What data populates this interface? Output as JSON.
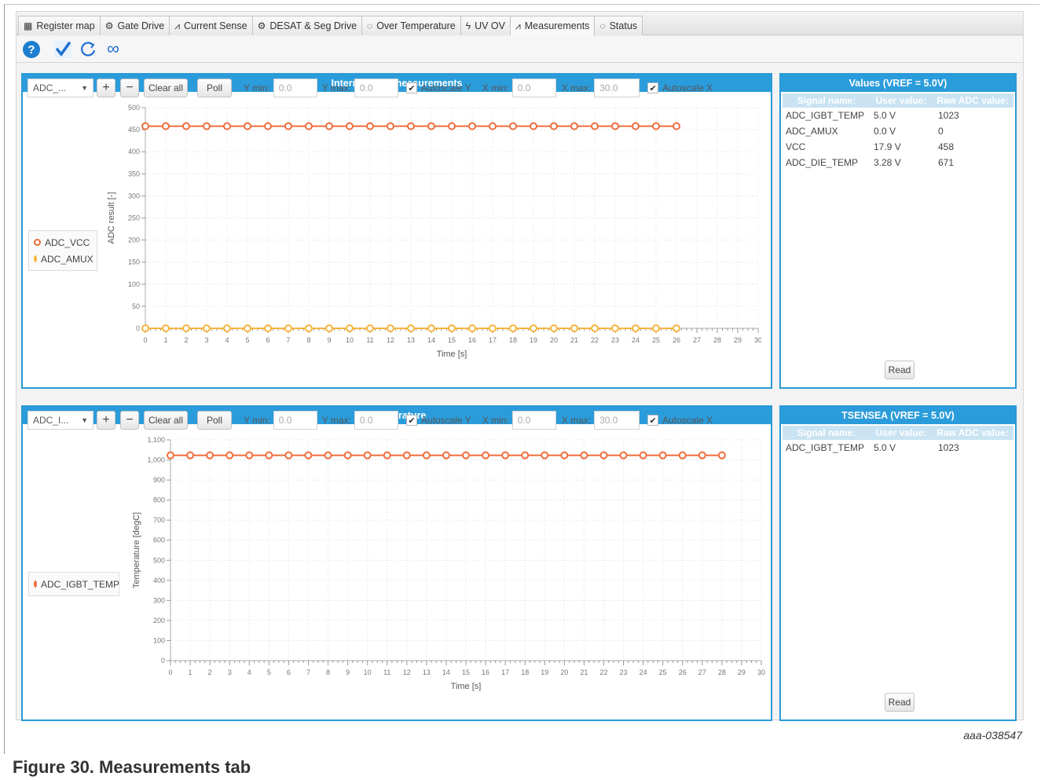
{
  "tabs": [
    {
      "label": "Register map",
      "icon": "grid-icon"
    },
    {
      "label": "Gate Drive",
      "icon": "gear-icon"
    },
    {
      "label": "Current Sense",
      "icon": "chart-icon"
    },
    {
      "label": "DESAT & Seg Drive",
      "icon": "gear-icon"
    },
    {
      "label": "Over Temperature",
      "icon": "shield-check-icon"
    },
    {
      "label": "UV OV",
      "icon": "lightning-icon"
    },
    {
      "label": "Measurements",
      "icon": "chart-icon"
    },
    {
      "label": "Status",
      "icon": "shield-check-icon"
    }
  ],
  "active_tab": "Measurements",
  "toolbar": {
    "help": "?",
    "check": "✔",
    "refresh": "⟳",
    "loop": "∞"
  },
  "adc_panel": {
    "title": "Internal ADC measurements",
    "dropdown": "ADC_...",
    "plus": "+",
    "minus": "−",
    "clear_all": "Clear all",
    "poll": "Poll",
    "ymin_label": "Y min:",
    "ymin_value": "0.0",
    "ymax_label": "Y max:",
    "ymax_value": "0.0",
    "autoscale_y": "Autoscale Y",
    "xmin_label": "X min:",
    "xmin_value": "0.0",
    "xmax_label": "X max:",
    "xmax_value": "30.0",
    "autoscale_x": "Autoscale X",
    "legend": [
      "ADC_VCC",
      "ADC_AMUX"
    ]
  },
  "temp_panel": {
    "title": "Temperature",
    "dropdown": "ADC_I...",
    "plus": "+",
    "minus": "−",
    "clear_all": "Clear all",
    "poll": "Poll",
    "ymin_label": "Y min:",
    "ymin_value": "0.0",
    "ymax_label": "Y max:",
    "ymax_value": "0.0",
    "autoscale_y": "Autoscale Y",
    "xmin_label": "X min:",
    "xmin_value": "0.0",
    "xmax_label": "X max:",
    "xmax_value": "30.0",
    "autoscale_x": "Autoscale X",
    "legend": [
      "ADC_IGBT_TEMP"
    ]
  },
  "values_panel": {
    "title": "Values (VREF = 5.0V)",
    "headers": [
      "Signal name:",
      "User value:",
      "Raw ADC value:"
    ],
    "rows": [
      [
        "ADC_IGBT_TEMP",
        "5.0 V",
        "1023"
      ],
      [
        "ADC_AMUX",
        "0.0 V",
        "0"
      ],
      [
        "VCC",
        "17.9 V",
        "458"
      ],
      [
        "ADC_DIE_TEMP",
        "3.28 V",
        "671"
      ]
    ],
    "read": "Read"
  },
  "tsense_panel": {
    "title": "TSENSEA (VREF = 5.0V)",
    "headers": [
      "Signal name:",
      "User value:",
      "Raw ADC value:"
    ],
    "rows": [
      [
        "ADC_IGBT_TEMP",
        "5.0 V",
        "1023"
      ]
    ],
    "read": "Read"
  },
  "chart_data": [
    {
      "type": "line",
      "title": "Internal ADC measurements",
      "xlabel": "Time [s]",
      "ylabel": "ADC result [-]",
      "xlim": [
        0,
        30
      ],
      "ylim": [
        0,
        500
      ],
      "xticks": [
        0,
        1,
        2,
        3,
        4,
        5,
        6,
        7,
        8,
        9,
        10,
        11,
        12,
        13,
        14,
        15,
        16,
        17,
        18,
        19,
        20,
        21,
        22,
        23,
        24,
        25,
        26,
        27,
        28,
        29,
        30
      ],
      "yticks": [
        0,
        50,
        100,
        150,
        200,
        250,
        300,
        350,
        400,
        450,
        500
      ],
      "grid": true,
      "legend_position": "left",
      "series": [
        {
          "name": "ADC_VCC",
          "color": "#ef6c3c",
          "x": [
            0,
            1,
            2,
            3,
            4,
            5,
            6,
            7,
            8,
            9,
            10,
            11,
            12,
            13,
            14,
            15,
            16,
            17,
            18,
            19,
            20,
            21,
            22,
            23,
            24,
            25,
            26
          ],
          "y": [
            458,
            458,
            458,
            458,
            458,
            458,
            458,
            458,
            458,
            458,
            458,
            458,
            458,
            458,
            458,
            458,
            458,
            458,
            458,
            458,
            458,
            458,
            458,
            458,
            458,
            458,
            458
          ]
        },
        {
          "name": "ADC_AMUX",
          "color": "#f4b43c",
          "x": [
            0,
            1,
            2,
            3,
            4,
            5,
            6,
            7,
            8,
            9,
            10,
            11,
            12,
            13,
            14,
            15,
            16,
            17,
            18,
            19,
            20,
            21,
            22,
            23,
            24,
            25,
            26
          ],
          "y": [
            0,
            0,
            0,
            0,
            0,
            0,
            0,
            0,
            0,
            0,
            0,
            0,
            0,
            0,
            0,
            0,
            0,
            0,
            0,
            0,
            0,
            0,
            0,
            0,
            0,
            0,
            0
          ]
        }
      ]
    },
    {
      "type": "line",
      "title": "Temperature",
      "xlabel": "Time [s]",
      "ylabel": "Temperature [degC]",
      "xlim": [
        0,
        30
      ],
      "ylim": [
        0,
        1100
      ],
      "xticks": [
        0,
        1,
        2,
        3,
        4,
        5,
        6,
        7,
        8,
        9,
        10,
        11,
        12,
        13,
        14,
        15,
        16,
        17,
        18,
        19,
        20,
        21,
        22,
        23,
        24,
        25,
        26,
        27,
        28,
        29,
        30
      ],
      "yticks": [
        0,
        100,
        200,
        300,
        400,
        500,
        600,
        700,
        800,
        900,
        1000,
        1100
      ],
      "ytick_labels": [
        "0",
        "100",
        "200",
        "300",
        "400",
        "500",
        "600",
        "700",
        "800",
        "900",
        "1,000",
        "1,100"
      ],
      "grid": true,
      "legend_position": "left",
      "series": [
        {
          "name": "ADC_IGBT_TEMP",
          "color": "#ef6c3c",
          "x": [
            0,
            1,
            2,
            3,
            4,
            5,
            6,
            7,
            8,
            9,
            10,
            11,
            12,
            13,
            14,
            15,
            16,
            17,
            18,
            19,
            20,
            21,
            22,
            23,
            24,
            25,
            26,
            27,
            28
          ],
          "y": [
            1023,
            1023,
            1023,
            1023,
            1023,
            1023,
            1023,
            1023,
            1023,
            1023,
            1023,
            1023,
            1023,
            1023,
            1023,
            1023,
            1023,
            1023,
            1023,
            1023,
            1023,
            1023,
            1023,
            1023,
            1023,
            1023,
            1023,
            1023,
            1023
          ]
        }
      ]
    }
  ],
  "figure": {
    "code": "aaa-038547",
    "caption": "Figure 30.  Measurements tab"
  }
}
